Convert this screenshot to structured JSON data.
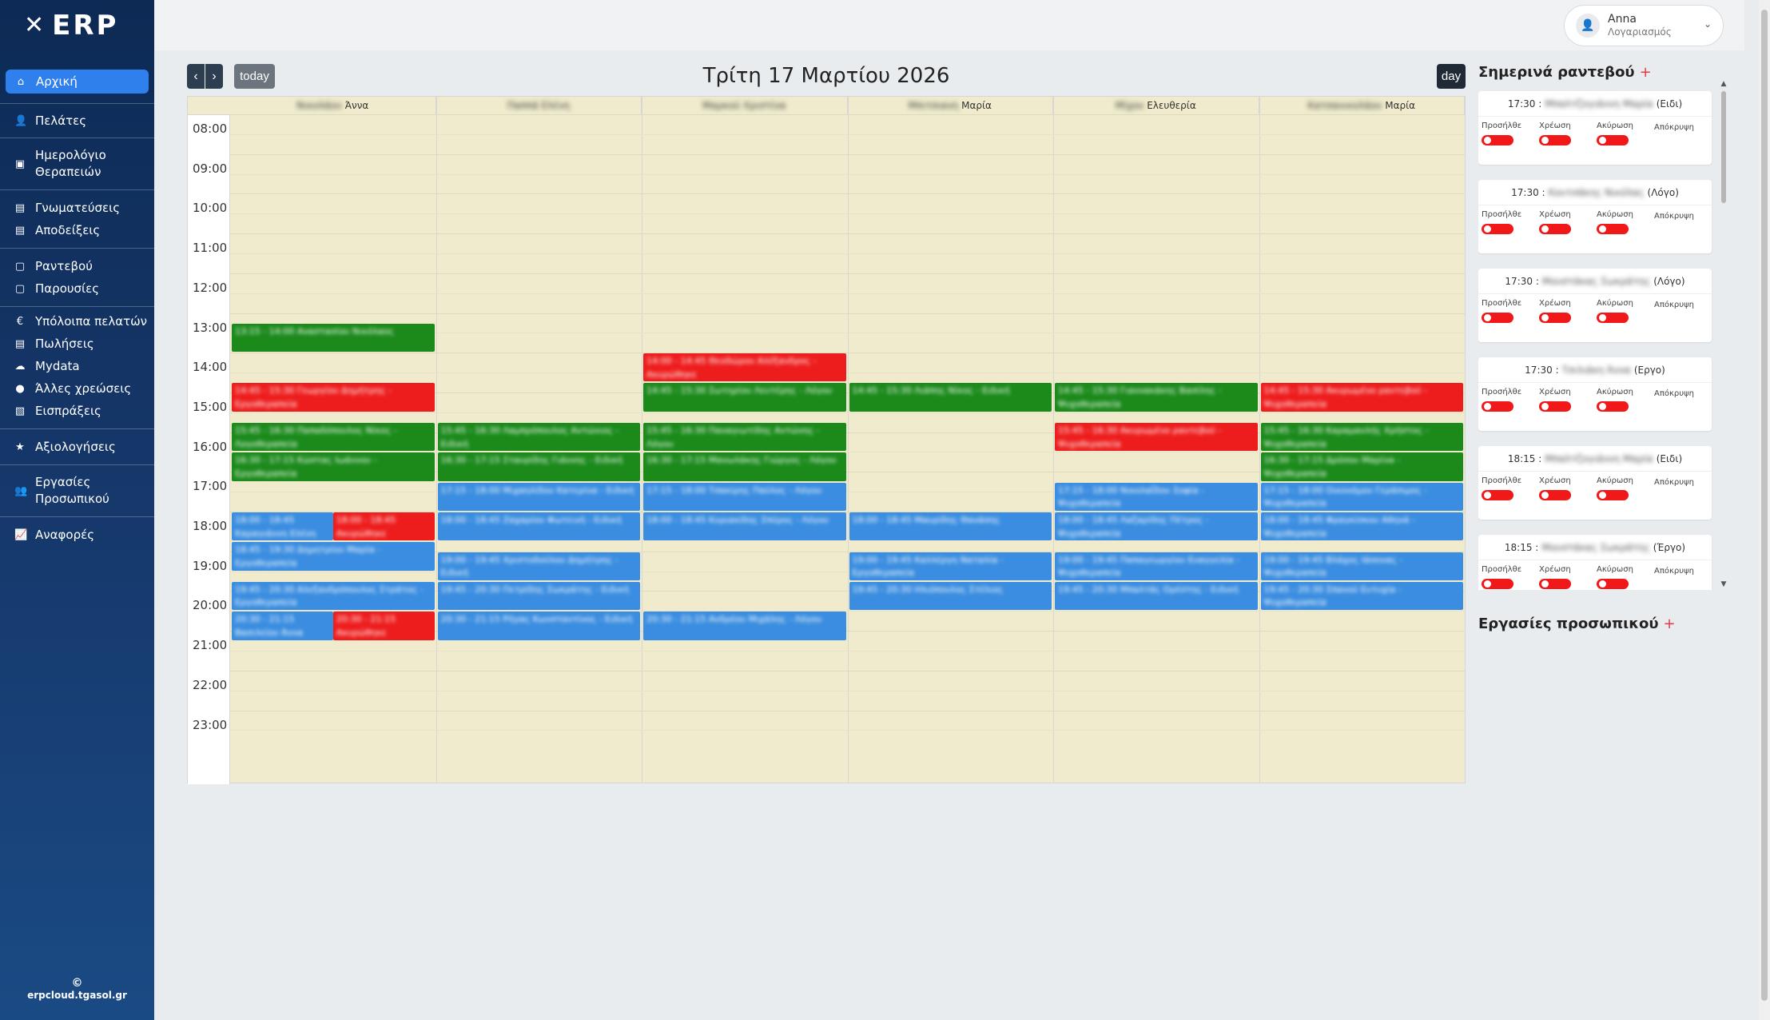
{
  "sidebar": {
    "brand": "ERP",
    "items": [
      {
        "label": "Αρχική",
        "icon": "home-icon",
        "glyph": "⌂"
      },
      {
        "label": "Πελάτες",
        "icon": "user-icon",
        "glyph": "👤"
      },
      {
        "label": "Ημερολόγιο Θεραπειών",
        "icon": "calendar-book-icon",
        "glyph": "▣"
      },
      {
        "label": "Γνωματεύσεις",
        "icon": "document-icon",
        "glyph": "▤"
      },
      {
        "label": "Αποδείξεις",
        "icon": "receipt-icon",
        "glyph": "▤"
      },
      {
        "label": "Ραντεβού",
        "icon": "calendar-icon",
        "glyph": "▢"
      },
      {
        "label": "Παρουσίες",
        "icon": "attendance-icon",
        "glyph": "▢"
      },
      {
        "label": "Υπόλοιπα πελατών",
        "icon": "euro-icon",
        "glyph": "€"
      },
      {
        "label": "Πωλήσεις",
        "icon": "sales-icon",
        "glyph": "▤"
      },
      {
        "label": "Mydata",
        "icon": "cloud-icon",
        "glyph": "☁"
      },
      {
        "label": "Άλλες χρεώσεις",
        "icon": "coins-icon",
        "glyph": "●"
      },
      {
        "label": "Εισπράξεις",
        "icon": "cash-icon",
        "glyph": "▧"
      },
      {
        "label": "Αξιολογήσεις",
        "icon": "rating-icon",
        "glyph": "★"
      },
      {
        "label": "Εργασίες Προσωπικού",
        "icon": "staff-icon",
        "glyph": "👥"
      },
      {
        "label": "Αναφορές",
        "icon": "chart-icon",
        "glyph": "📈"
      }
    ],
    "copyright": "©",
    "footer": "erpcloud.tgasol.gr"
  },
  "account": {
    "name": "Anna",
    "sub": "Λογαριασμός"
  },
  "calendar": {
    "title": "Τρίτη 17 Μαρτίου 2026",
    "today_label": "today",
    "day_label": "day",
    "prev_label": "‹",
    "next_label": "›",
    "resources": [
      "Νικολάου Άννα",
      "Παππά Ελένη",
      "Μαρκού Χριστίνα",
      "Μπιτσιανη Μαρία",
      "Μίχου Ελευθερία",
      "Κατσανικολάου Μαρία"
    ],
    "resource_visible": [
      "Άννα",
      "",
      "",
      "Μαρία",
      "Ελευθερία",
      "Μαρία"
    ],
    "hours": [
      "08:00",
      "09:00",
      "10:00",
      "11:00",
      "12:00",
      "13:00",
      "14:00",
      "15:00",
      "16:00",
      "17:00",
      "18:00",
      "19:00",
      "20:00",
      "21:00",
      "22:00",
      "23:00"
    ],
    "events": [
      {
        "col": 0,
        "start": "13:15",
        "end": "14:00",
        "color": "green",
        "text": "13:15 - 14:00 Αναστασίου Νικόλαος"
      },
      {
        "col": 0,
        "start": "14:45",
        "end": "15:30",
        "color": "red",
        "text": "14:45 - 15:30 Γεωργίου Δημήτρης - Εργοθεραπεία"
      },
      {
        "col": 0,
        "start": "15:45",
        "end": "16:30",
        "color": "green",
        "text": "15:45 - 16:30 Παπαδόπουλος Νίκος - Λογοθεραπεία"
      },
      {
        "col": 0,
        "start": "16:30",
        "end": "17:15",
        "color": "green",
        "text": "16:30 - 17:15 Κώστας Ιωάννου - Εργοθεραπεία"
      },
      {
        "col": 0,
        "start": "18:00",
        "end": "18:45",
        "color": "blue",
        "half": "left",
        "text": "18:00 - 18:45 Καραγιάννη Ελένη"
      },
      {
        "col": 0,
        "start": "18:00",
        "end": "18:45",
        "color": "red",
        "half": "right",
        "text": "18:00 - 18:45 Ακυρώθηκε"
      },
      {
        "col": 0,
        "start": "18:45",
        "end": "19:30",
        "color": "blue",
        "text": "18:45 - 19:30 Δημητρίου Μαρία - Εργοθεραπεία"
      },
      {
        "col": 0,
        "start": "19:45",
        "end": "20:30",
        "color": "blue",
        "text": "19:45 - 20:30 Αλεξανδρόπουλος Στράτος - Εργοθεραπεία"
      },
      {
        "col": 0,
        "start": "20:30",
        "end": "21:15",
        "color": "blue",
        "half": "left",
        "text": "20:30 - 21:15 Βασιλείου Άννα"
      },
      {
        "col": 0,
        "start": "20:30",
        "end": "21:15",
        "color": "red",
        "half": "right",
        "text": "20:30 - 21:15 Ακυρώθηκε"
      },
      {
        "col": 1,
        "start": "15:45",
        "end": "16:30",
        "color": "green",
        "text": "15:45 - 16:30 Λαμπρόπουλος Αντώνιος - Ειδική"
      },
      {
        "col": 1,
        "start": "16:30",
        "end": "17:15",
        "color": "green",
        "text": "16:30 - 17:15 Σταυρίδης Γιάννης - Ειδική"
      },
      {
        "col": 1,
        "start": "17:15",
        "end": "18:00",
        "color": "blue",
        "text": "17:15 - 18:00 Μιχαηλίδου Κατερίνα - Ειδική"
      },
      {
        "col": 1,
        "start": "18:00",
        "end": "18:45",
        "color": "blue",
        "text": "18:00 - 18:45 Ζαχαρίου Φωτεινή - Ειδική"
      },
      {
        "col": 1,
        "start": "19:00",
        "end": "19:45",
        "color": "blue",
        "text": "19:00 - 19:45 Χριστοδούλου Δημήτρης - Ειδική"
      },
      {
        "col": 1,
        "start": "19:45",
        "end": "20:30",
        "color": "blue",
        "text": "19:45 - 20:30 Πετρίδης Σωκράτης - Ειδική"
      },
      {
        "col": 1,
        "start": "20:30",
        "end": "21:15",
        "color": "blue",
        "text": "20:30 - 21:15 Ρήγας Κωνσταντίνος - Ειδική"
      },
      {
        "col": 2,
        "start": "14:00",
        "end": "14:45",
        "color": "red",
        "text": "14:00 - 14:45 Θεοδώρου Αλέξανδρος - Ακυρώθηκε"
      },
      {
        "col": 2,
        "start": "14:45",
        "end": "15:30",
        "color": "green",
        "text": "14:45 - 15:30 Σωτηρίου Λευτέρης - Λόγου"
      },
      {
        "col": 2,
        "start": "15:45",
        "end": "16:30",
        "color": "green",
        "text": "15:45 - 16:30 Παναγιωτίδης Αντώνης - Λόγου"
      },
      {
        "col": 2,
        "start": "16:30",
        "end": "17:15",
        "color": "green",
        "text": "16:30 - 17:15 Μανωλάκης Γιώργος - Λόγου"
      },
      {
        "col": 2,
        "start": "17:15",
        "end": "18:00",
        "color": "blue",
        "text": "17:15 - 18:00 Τσακίρης Παύλος - Λόγου"
      },
      {
        "col": 2,
        "start": "18:00",
        "end": "18:45",
        "color": "blue",
        "text": "18:00 - 18:45 Κυριακίδης Σπύρος - Λόγου"
      },
      {
        "col": 2,
        "start": "20:30",
        "end": "21:15",
        "color": "blue",
        "text": "20:30 - 21:15 Ανδρέου Μιχάλης - Λόγου"
      },
      {
        "col": 3,
        "start": "14:45",
        "end": "15:30",
        "color": "green",
        "text": "14:45 - 15:30 Λιάπης Νίκος - Ειδική"
      },
      {
        "col": 3,
        "start": "18:00",
        "end": "18:45",
        "color": "blue",
        "text": "18:00 - 18:45 Μαυρίδης Θανάσης"
      },
      {
        "col": 3,
        "start": "19:00",
        "end": "19:45",
        "color": "blue",
        "text": "19:00 - 19:45 Καλλέργη Ναταλία - Εργοθεραπεία"
      },
      {
        "col": 3,
        "start": "19:45",
        "end": "20:30",
        "color": "blue",
        "text": "19:45 - 20:30 Ηλιόπουλος Στέλιος"
      },
      {
        "col": 4,
        "start": "14:45",
        "end": "15:30",
        "color": "green",
        "text": "14:45 - 15:30 Γιαννακάκης Βασίλης - Ψυχοθεραπεία"
      },
      {
        "col": 4,
        "start": "15:45",
        "end": "16:30",
        "color": "red",
        "text": "15:45 - 16:30 Ακυρωμένο ραντεβού - Ψυχοθεραπεία"
      },
      {
        "col": 4,
        "start": "17:15",
        "end": "18:00",
        "color": "blue",
        "text": "17:15 - 18:00 Νικολαΐδου Σοφία - Ψυχοθεραπεία"
      },
      {
        "col": 4,
        "start": "18:00",
        "end": "18:45",
        "color": "blue",
        "text": "18:00 - 18:45 Λαζαρίδης Πέτρος - Ψυχοθεραπεία"
      },
      {
        "col": 4,
        "start": "19:00",
        "end": "19:45",
        "color": "blue",
        "text": "19:00 - 19:45 Παπαγεωργίου Ευαγγελία - Ψυχοθεραπεία"
      },
      {
        "col": 4,
        "start": "19:45",
        "end": "20:30",
        "color": "blue",
        "text": "19:45 - 20:30 Μπαλτάς Ορέστης - Ειδική"
      },
      {
        "col": 5,
        "start": "14:45",
        "end": "15:30",
        "color": "red",
        "text": "14:45 - 15:30 Ακυρωμένο ραντεβού - Ψυχοθεραπεία"
      },
      {
        "col": 5,
        "start": "15:45",
        "end": "16:30",
        "color": "green",
        "text": "15:45 - 16:30 Καραμανλής Χρήστος - Ψυχοθεραπεία"
      },
      {
        "col": 5,
        "start": "16:30",
        "end": "17:15",
        "color": "green",
        "text": "16:30 - 17:15 Δρόσου Μαρίνα - Ψυχοθεραπεία"
      },
      {
        "col": 5,
        "start": "17:15",
        "end": "18:00",
        "color": "blue",
        "text": "17:15 - 18:00 Οικονόμου Γεράσιμος - Ψυχοθεραπεία"
      },
      {
        "col": 5,
        "start": "18:00",
        "end": "18:45",
        "color": "blue",
        "text": "18:00 - 18:45 Φραγκίσκου Αθηνά - Ψυχοθεραπεία"
      },
      {
        "col": 5,
        "start": "19:00",
        "end": "19:45",
        "color": "blue",
        "text": "19:00 - 19:45 Βλάχος Ιάσονας - Ψυχοθεραπεία"
      },
      {
        "col": 5,
        "start": "19:45",
        "end": "20:30",
        "color": "blue",
        "text": "19:45 - 20:30 Σπανού Ευτυχία - Ψυχοθεραπεία"
      }
    ]
  },
  "today_panel": {
    "title": "Σημερινά ραντεβού",
    "add_label": "+",
    "toggle_labels": [
      "Προσήλθε",
      "Χρέωση",
      "Ακύρωση",
      "Απόκρυψη"
    ],
    "appointments": [
      {
        "time": "17:30 :",
        "name": "Μπαλτζογιάννη Μαρία",
        "type": "(Ειδι)"
      },
      {
        "time": "17:30 :",
        "name": "Κουτσάκης Νικόλας",
        "type": "(Λόγο)"
      },
      {
        "time": "17:30 :",
        "name": "Μουστάκας Σωκράτης",
        "type": "(Λόγο)"
      },
      {
        "time": "17:30 :",
        "name": "Τσιλιάκη Άννα",
        "type": "(Εργο)"
      },
      {
        "time": "18:15 :",
        "name": "Μπαλτζογιάννη Μαρία",
        "type": "(Ειδι)"
      },
      {
        "time": "18:15 :",
        "name": "Μουστάκας Σωκράτης",
        "type": "(Έργο)"
      }
    ]
  },
  "staff_tasks": {
    "title": "Εργασίες προσωπικού",
    "add_label": "+"
  },
  "colors": {
    "green": "#1b8a1b",
    "red": "#ee1d1d",
    "blue": "#3a8de0",
    "sidebar": "#16386b",
    "active": "#2f80ed",
    "grid_bg": "#efebcc"
  }
}
